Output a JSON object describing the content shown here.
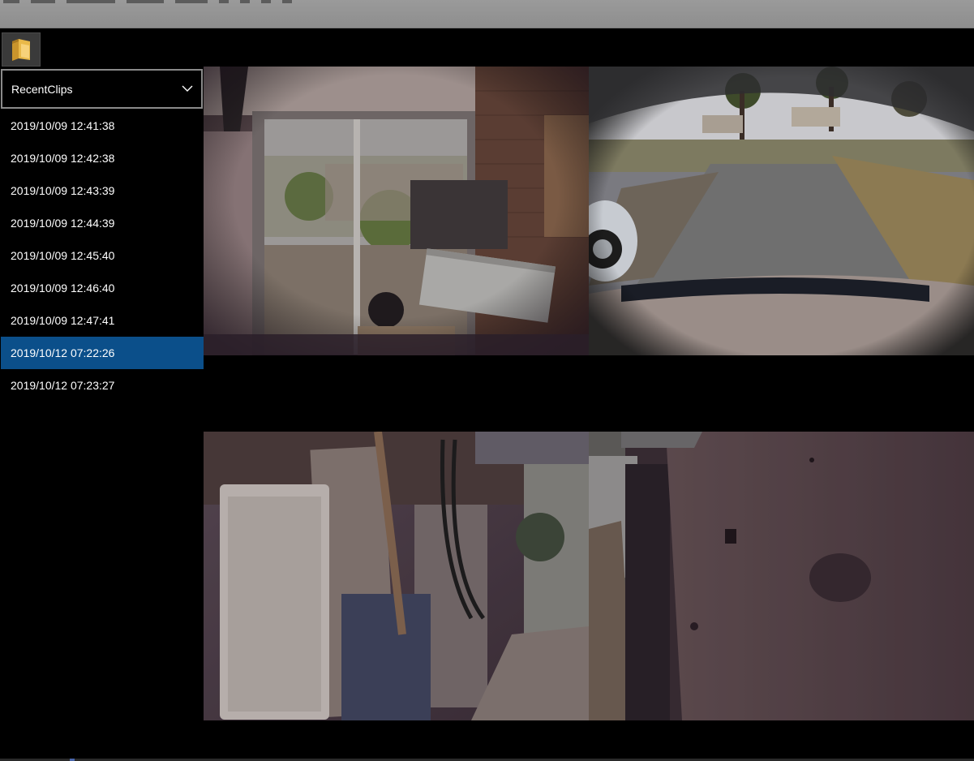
{
  "window": {
    "title": ""
  },
  "toolbar": {
    "open_folder_icon": "folder-icon"
  },
  "folder_select": {
    "selected": "RecentClips",
    "chevron_icon": "chevron-down-icon"
  },
  "clips": [
    {
      "label": "2019/10/09 12:41:38",
      "selected": false
    },
    {
      "label": "2019/10/09 12:42:38",
      "selected": false
    },
    {
      "label": "2019/10/09 12:43:39",
      "selected": false
    },
    {
      "label": "2019/10/09 12:44:39",
      "selected": false
    },
    {
      "label": "2019/10/09 12:45:40",
      "selected": false
    },
    {
      "label": "2019/10/09 12:46:40",
      "selected": false
    },
    {
      "label": "2019/10/09 12:47:41",
      "selected": false
    },
    {
      "label": "2019/10/12 07:22:26",
      "selected": true
    },
    {
      "label": "2019/10/12 07:23:27",
      "selected": false
    }
  ],
  "cameras": [
    {
      "id": "front",
      "label": ""
    },
    {
      "id": "back",
      "label": ""
    },
    {
      "id": "left_repeater",
      "label": ""
    },
    {
      "id": "right_repeater",
      "label": ""
    }
  ],
  "colors": {
    "background": "#000000",
    "selection": "#0b4f8a",
    "titlebar": "#949494",
    "text": "#ffffff"
  }
}
